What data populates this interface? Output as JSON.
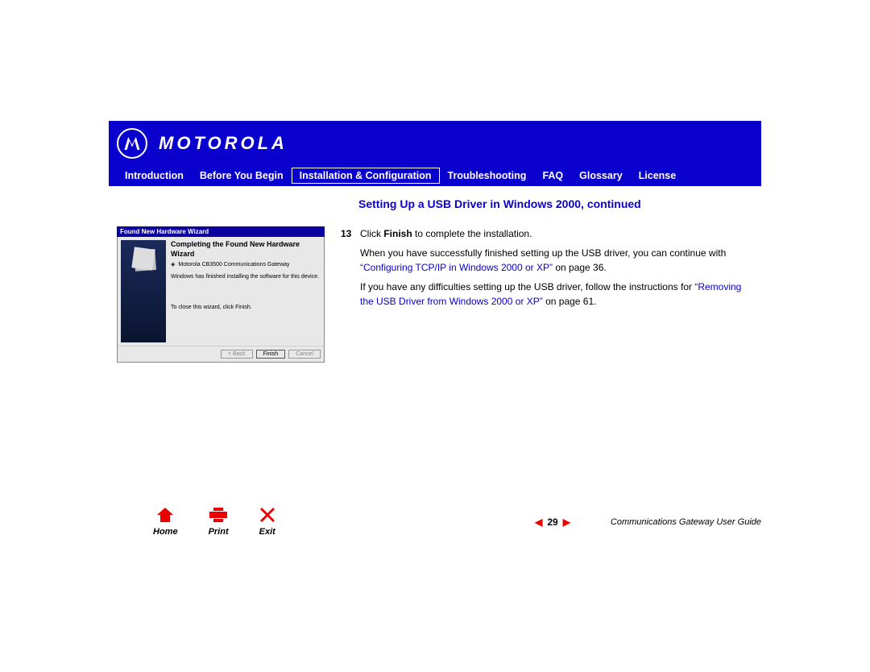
{
  "brand": "MOTOROLA",
  "nav": {
    "items": [
      {
        "label": "Introduction"
      },
      {
        "label": "Before You Begin"
      },
      {
        "label": "Installation & Configuration"
      },
      {
        "label": "Troubleshooting"
      },
      {
        "label": "FAQ"
      },
      {
        "label": "Glossary"
      },
      {
        "label": "License"
      }
    ],
    "active_index": 2
  },
  "section_title": "Setting Up a USB Driver in Windows 2000, continued",
  "wizard": {
    "titlebar": "Found New Hardware Wizard",
    "heading": "Completing the Found New Hardware Wizard",
    "device": "Motorola CB3500 Communications Gateway",
    "line1": "Windows has finished installing the software for this device.",
    "line2": "To close this wizard, click Finish.",
    "buttons": {
      "back": "< Back",
      "finish": "Finish",
      "cancel": "Cancel"
    }
  },
  "step": {
    "num": "13",
    "pre": "Click ",
    "bold": "Finish",
    "post": " to complete the installation."
  },
  "p1": {
    "a": "When you have successfully finished setting up the USB driver, you can continue with ",
    "link": "“Configuring TCP/IP in Windows 2000 or XP”",
    "b": " on page 36."
  },
  "p2": {
    "a": "If you have any difficulties setting up the USB driver, follow the instructions for ",
    "link": "“Removing the USB Driver from Windows 2000 or XP”",
    "b": " on page 61."
  },
  "footer": {
    "home": "Home",
    "print": "Print",
    "exit": "Exit",
    "page": "29",
    "guide": "Communications Gateway User Guide"
  }
}
